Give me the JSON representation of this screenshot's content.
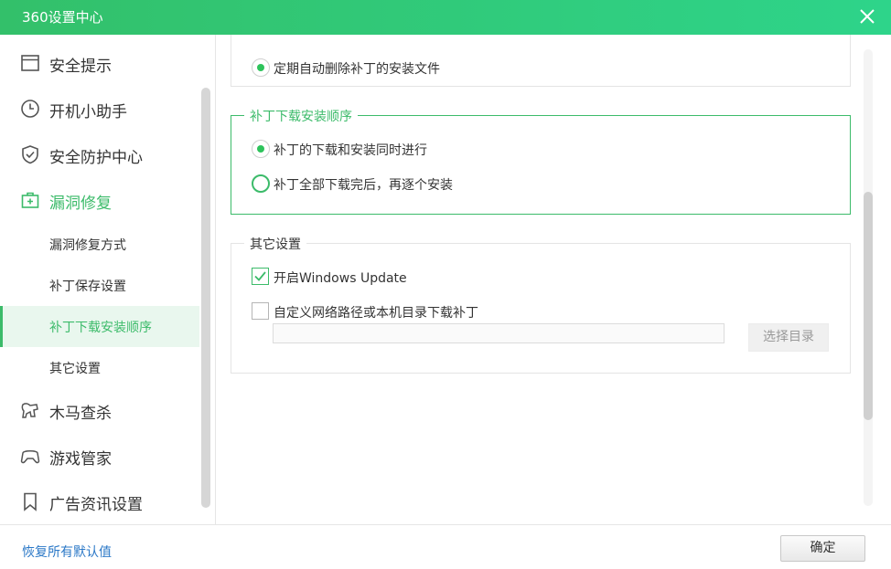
{
  "window": {
    "title": "360设置中心",
    "close_icon": "close-icon"
  },
  "sidebar": {
    "items": [
      {
        "label": "安全提示",
        "icon": "window-icon"
      },
      {
        "label": "开机小助手",
        "icon": "clock-icon"
      },
      {
        "label": "安全防护中心",
        "icon": "shield-check-icon"
      },
      {
        "label": "漏洞修复",
        "icon": "medkit-icon"
      },
      {
        "label": "木马查杀",
        "icon": "horse-icon"
      },
      {
        "label": "游戏管家",
        "icon": "gamepad-icon"
      },
      {
        "label": "广告资讯设置",
        "icon": "bookmark-icon"
      }
    ],
    "subitems": [
      {
        "label": "漏洞修复方式"
      },
      {
        "label": "补丁保存设置"
      },
      {
        "label": "补丁下载安装顺序"
      },
      {
        "label": "其它设置"
      }
    ]
  },
  "main": {
    "top_option": "定期自动删除补丁的安装文件",
    "order_section": {
      "title": "补丁下载安装顺序",
      "options": [
        "补丁的下载和安装同时进行",
        "补丁全部下载完后，再逐个安装"
      ],
      "selected": 0
    },
    "other_section": {
      "title": "其它设置",
      "windows_update_label": "开启Windows Update",
      "windows_update_checked": true,
      "custom_path_label": "自定义网络路径或本机目录下载补丁",
      "custom_path_checked": false,
      "path_value": "",
      "choose_dir_label": "选择目录"
    }
  },
  "footer": {
    "restore_label": "恢复所有默认值",
    "ok_label": "确定"
  },
  "colors": {
    "accent": "#3cbb6a",
    "titlebar": "#2fcf73",
    "link": "#2b78c7"
  }
}
